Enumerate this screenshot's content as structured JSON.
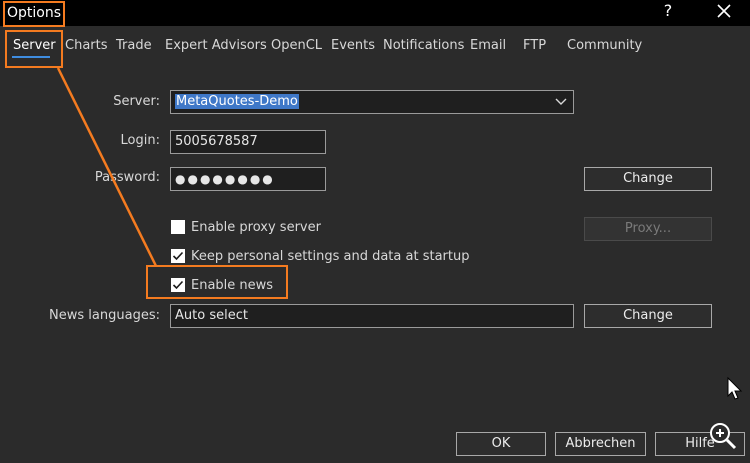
{
  "window": {
    "title": "Options",
    "help_icon": "?",
    "close_icon": "close-icon"
  },
  "tabs": [
    {
      "label": "Server",
      "active": true
    },
    {
      "label": "Charts"
    },
    {
      "label": "Trade"
    },
    {
      "label": "Expert Advisors"
    },
    {
      "label": "OpenCL"
    },
    {
      "label": "Events"
    },
    {
      "label": "Notifications"
    },
    {
      "label": "Email"
    },
    {
      "label": "FTP"
    },
    {
      "label": "Community"
    }
  ],
  "server_tab": {
    "server_label": "Server:",
    "server_value": "MetaQuotes-Demo",
    "login_label": "Login:",
    "login_value": "5005678587",
    "password_label": "Password:",
    "password_value": "●●●●●●●●",
    "change_password_button": "Change",
    "enable_proxy": {
      "label": "Enable proxy server",
      "checked": false
    },
    "proxy_button": "Proxy...",
    "keep_settings": {
      "label": "Keep personal settings and data at startup",
      "checked": true
    },
    "enable_news": {
      "label": "Enable news",
      "checked": true
    },
    "news_languages_label": "News languages:",
    "news_languages_value": "Auto select",
    "change_languages_button": "Change"
  },
  "footer": {
    "ok_button": "OK",
    "cancel_button": "Abbrechen",
    "help_button": "Hilfe"
  },
  "colors": {
    "accent_highlight": "#f47b20",
    "tab_underline": "#3f8de0",
    "selection": "#3f78c8"
  }
}
